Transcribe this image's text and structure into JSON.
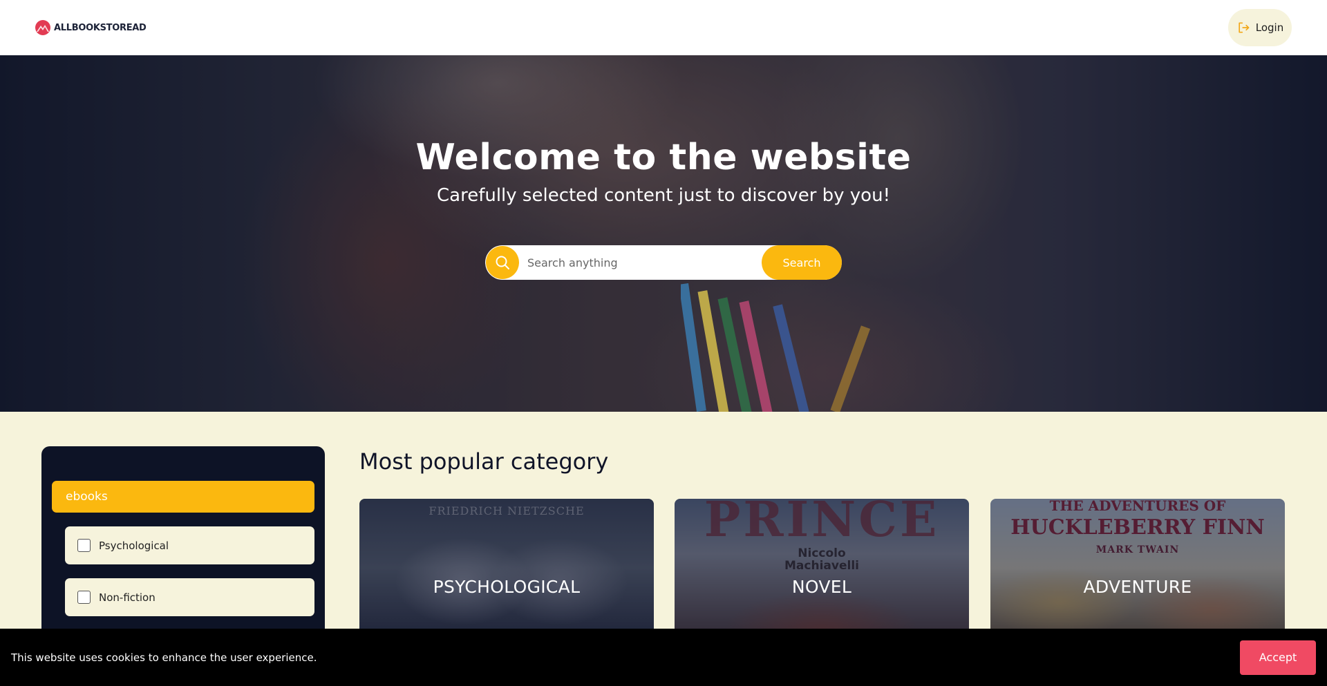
{
  "header": {
    "brand_name": "ALLBOOKSTOREAD",
    "login_label": "Login"
  },
  "hero": {
    "title": "Welcome to the website",
    "subtitle": "Carefully selected content just to discover by you!",
    "search_placeholder": "Search anything",
    "search_button": "Search"
  },
  "sidebar": {
    "active_item": "ebooks",
    "filters": [
      {
        "label": "Psychological",
        "checked": false
      },
      {
        "label": "Non-fiction",
        "checked": false
      }
    ]
  },
  "main": {
    "section_title": "Most popular category",
    "categories": [
      {
        "label": "PSYCHOLOGICAL",
        "cover_text": "FRIEDRICH NIETZSCHE"
      },
      {
        "label": "NOVEL",
        "cover_title": "PRINCE",
        "cover_author": "Niccolo Machiavelli"
      },
      {
        "label": "ADVENTURE",
        "cover_title_top": "THE ADVENTURES OF",
        "cover_title": "HUCKLEBERRY FINN",
        "cover_author": "MARK TWAIN"
      }
    ]
  },
  "cookie_banner": {
    "text": "This website uses cookies to enhance the user experience.",
    "accept_label": "Accept"
  },
  "colors": {
    "accent": "#fbb80f",
    "dark_panel": "#0d1326",
    "cream": "#f6f3db",
    "accept": "#f04a63"
  },
  "icons": {
    "brand": "mountain-logo-icon",
    "login": "login-arrow-icon",
    "search": "search-icon"
  }
}
